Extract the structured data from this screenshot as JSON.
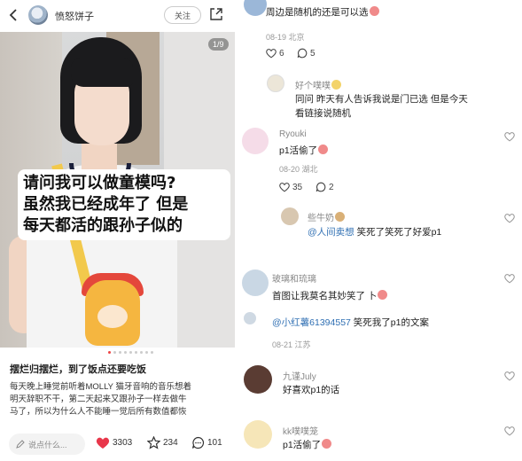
{
  "left": {
    "username": "愤怒饼子",
    "follow_label": "关注",
    "image_counter": "1/9",
    "caption_lines": [
      "请问我可以做童模吗?",
      "虽然我已经成年了 但是",
      "每天都活的跟孙子似的"
    ],
    "post_title": "摆烂归摆烂，到了饭点还要吃饭",
    "post_desc": [
      "每天晚上睡觉前听着MOLLY 猫牙音响的音乐想着",
      "明天辞职不干，第二天起来又跟孙子一样去做牛",
      "马了，所以为什么人不能睡一觉后所有数值都恢"
    ],
    "comment_placeholder": "说点什么...",
    "likes": "3303",
    "stars": "234",
    "comments": "101"
  },
  "right": {
    "comments": [
      {
        "name": "",
        "text": "周边是随机的还是可以选",
        "meta": "08-19 北京",
        "likes": "6",
        "replies": "5"
      },
      {
        "name": "好个噗噗",
        "text1": "同问 昨天有人告诉我说是门已选 但是今天",
        "text2": "看链接说随机"
      },
      {
        "name": "Ryouki",
        "text": "p1活偷了",
        "meta": "08-20 湖北",
        "likes": "35",
        "replies": "2"
      },
      {
        "name": "些牛奶",
        "mention": "@人间卖想",
        "text": " 笑死了笑死了好爱p1"
      },
      {
        "name": "玻璃和琉璃",
        "text": "首图让我莫名其妙笑了 卜"
      },
      {
        "mention": "@小红薯61394557",
        "text": " 笑死我了p1的文案",
        "meta": "08-21 江苏"
      },
      {
        "name": "九谨July",
        "text": "好喜欢p1的话"
      },
      {
        "name": "kk噗噗笼",
        "text": "p1活偷了"
      }
    ]
  },
  "colors": {
    "accent": "#e8374b",
    "link": "#2f6fb3"
  }
}
